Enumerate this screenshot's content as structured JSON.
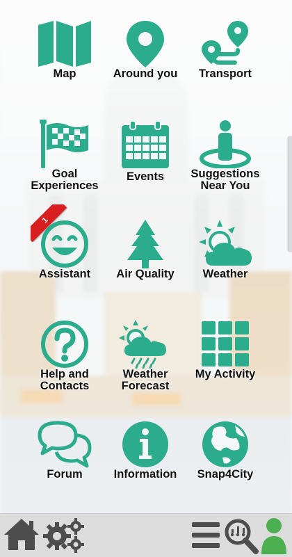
{
  "tiles": [
    {
      "label": "Map",
      "icon": "map-icon"
    },
    {
      "label": "Around you",
      "icon": "location-pin-icon"
    },
    {
      "label": "Transport",
      "icon": "route-icon"
    },
    {
      "label": "Goal\nExperiences",
      "icon": "checkered-flag-icon"
    },
    {
      "label": "Events",
      "icon": "calendar-icon"
    },
    {
      "label": "Suggestions\nNear You",
      "icon": "person-pin-icon"
    },
    {
      "label": "Assistant",
      "icon": "smiley-icon"
    },
    {
      "label": "Air Quality",
      "icon": "tree-icon"
    },
    {
      "label": "Weather",
      "icon": "sun-cloud-icon"
    },
    {
      "label": "Help and\nContacts",
      "icon": "question-icon"
    },
    {
      "label": "Weather\nForecast",
      "icon": "sun-rain-icon"
    },
    {
      "label": "My Activity",
      "icon": "grid-icon"
    },
    {
      "label": "Forum",
      "icon": "chat-bubbles-icon"
    },
    {
      "label": "Information",
      "icon": "info-icon"
    },
    {
      "label": "Snap4City",
      "icon": "globe-icon"
    }
  ],
  "assistant_badge": "1",
  "bottom_bar": {
    "home": "home-icon",
    "settings": "gears-icon",
    "menu": "menu-icon",
    "search": "search-icon",
    "profile": "user-icon"
  },
  "colors": {
    "accent": "#2bac8c",
    "badge": "#d91e20",
    "bar": "#dcdcdc",
    "bar_icon": "#4d4d4d",
    "profile": "#4caf50"
  }
}
